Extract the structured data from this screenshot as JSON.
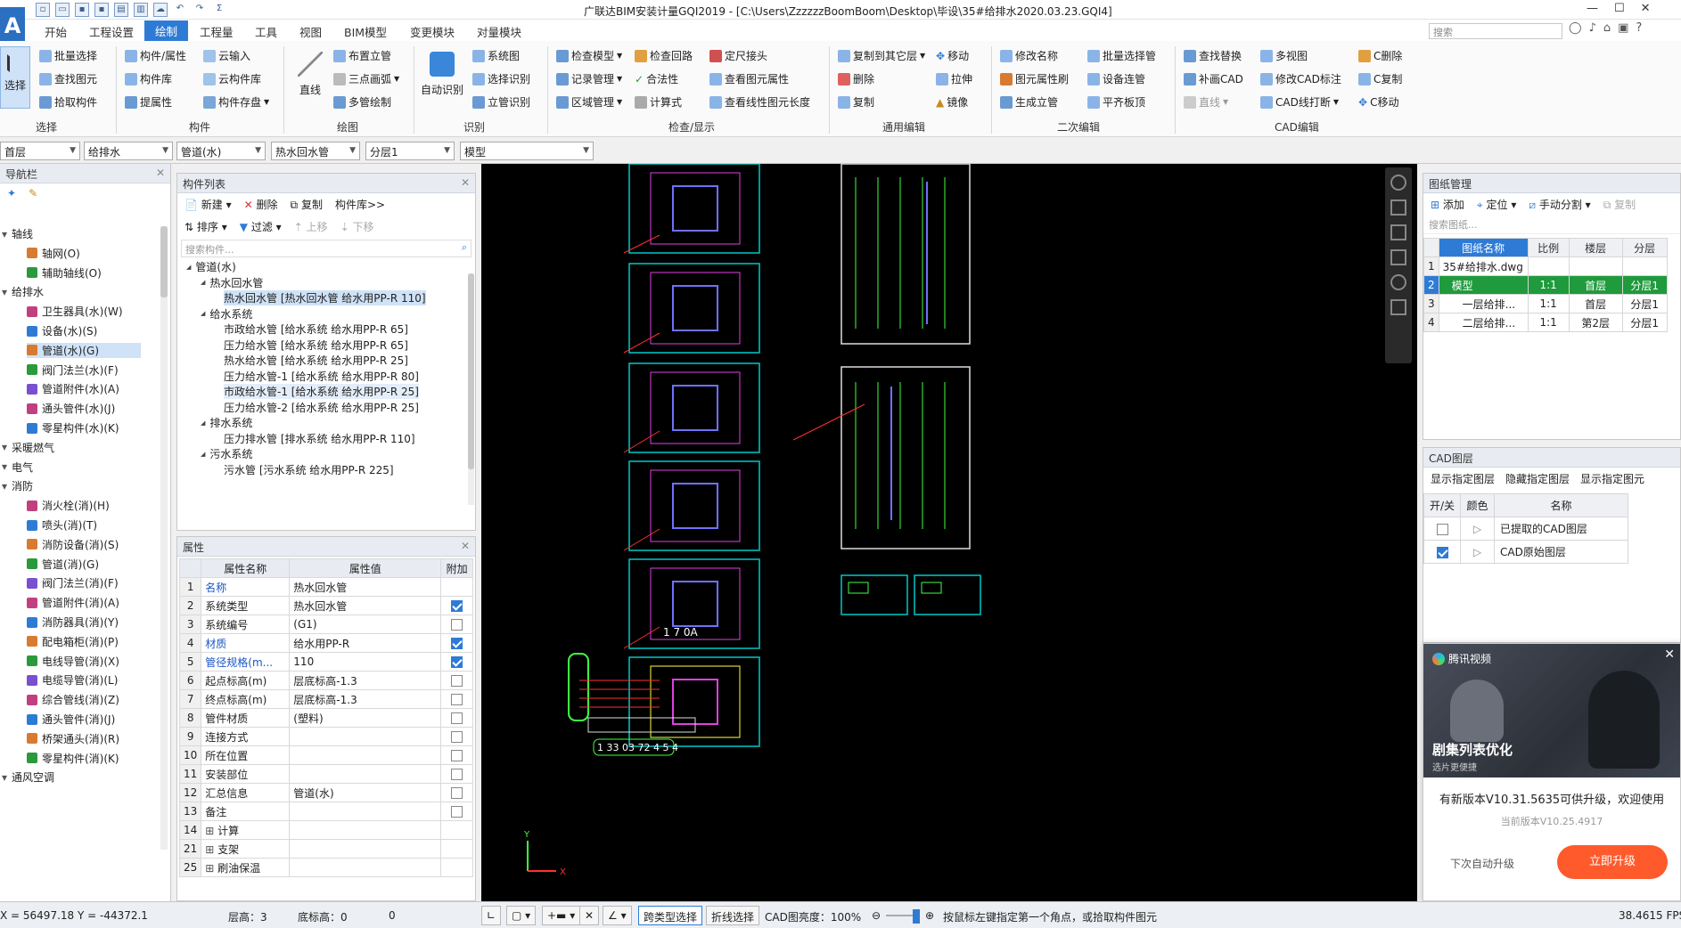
{
  "window": {
    "title": "广联达BIM安装计量GQI2019 - [C:\\Users\\ZzzzzzBoomBoom\\Desktop\\毕设\\35#给排水2020.03.23.GQI4]",
    "search_placeholder": "搜索",
    "logo": "A"
  },
  "tabs": [
    "开始",
    "工程设置",
    "绘制",
    "工程量",
    "工具",
    "视图",
    "BIM模型",
    "变更模块",
    "对量模块"
  ],
  "active_tab": "绘制",
  "ribbon": {
    "select": {
      "big": "选择",
      "items": [
        "批量选择",
        "查找图元",
        "拾取构件"
      ],
      "group": "选择"
    },
    "component": {
      "items": [
        "构件/属性",
        "构件库",
        "提属性",
        "云输入",
        "云构件库",
        "构件存盘"
      ],
      "group": "构件"
    },
    "draw": {
      "big": "直线",
      "items": [
        "布置立管",
        "三点画弧",
        "多管绘制"
      ],
      "group": "绘图"
    },
    "identify": {
      "big": "自动识别",
      "items": [
        "系统图",
        "选择识别",
        "立管识别"
      ],
      "group": "识别"
    },
    "check": {
      "items": [
        "检查模型",
        "记录管理",
        "区域管理",
        "检查回路",
        "合法性",
        "计算式",
        "定尺接头",
        "查看图元属性",
        "查看线性图元长度"
      ],
      "group": "检查/显示"
    },
    "general_edit": {
      "items": [
        "复制到其它层",
        "删除",
        "复制",
        "移动",
        "拉伸",
        "镜像"
      ],
      "group": "通用编辑"
    },
    "secondary_edit": {
      "items": [
        "修改名称",
        "图元属性刷",
        "生成立管",
        "批量选择管",
        "设备连管",
        "平齐板顶"
      ],
      "group": "二次编辑"
    },
    "cad_edit": {
      "items": [
        "查找替换",
        "补画CAD",
        "直线",
        "多视图",
        "修改CAD标注",
        "CAD线打断",
        "C删除",
        "C复制",
        "C移动"
      ],
      "group": "CAD编辑"
    }
  },
  "selectors": [
    "首层",
    "给排水",
    "管道(水)",
    "热水回水管",
    "分层1",
    "模型"
  ],
  "nav": {
    "title": "导航栏",
    "items": [
      {
        "label": "轴线",
        "level": 0
      },
      {
        "label": "轴网(O)",
        "level": 1
      },
      {
        "label": "辅助轴线(O)",
        "level": 1
      },
      {
        "label": "给排水",
        "level": 0
      },
      {
        "label": "卫生器具(水)(W)",
        "level": 1
      },
      {
        "label": "设备(水)(S)",
        "level": 1
      },
      {
        "label": "管道(水)(G)",
        "level": 1,
        "selected": true
      },
      {
        "label": "阀门法兰(水)(F)",
        "level": 1
      },
      {
        "label": "管道附件(水)(A)",
        "level": 1
      },
      {
        "label": "通头管件(水)(J)",
        "level": 1
      },
      {
        "label": "零星构件(水)(K)",
        "level": 1
      },
      {
        "label": "采暖燃气",
        "level": 0
      },
      {
        "label": "电气",
        "level": 0
      },
      {
        "label": "消防",
        "level": 0
      },
      {
        "label": "消火栓(消)(H)",
        "level": 1
      },
      {
        "label": "喷头(消)(T)",
        "level": 1
      },
      {
        "label": "消防设备(消)(S)",
        "level": 1
      },
      {
        "label": "管道(消)(G)",
        "level": 1
      },
      {
        "label": "阀门法兰(消)(F)",
        "level": 1
      },
      {
        "label": "管道附件(消)(A)",
        "level": 1
      },
      {
        "label": "消防器具(消)(Y)",
        "level": 1
      },
      {
        "label": "配电箱柜(消)(P)",
        "level": 1
      },
      {
        "label": "电线导管(消)(X)",
        "level": 1
      },
      {
        "label": "电缆导管(消)(L)",
        "level": 1
      },
      {
        "label": "综合管线(消)(Z)",
        "level": 1
      },
      {
        "label": "通头管件(消)(J)",
        "level": 1
      },
      {
        "label": "桥架通头(消)(R)",
        "level": 1
      },
      {
        "label": "零星构件(消)(K)",
        "level": 1
      },
      {
        "label": "通风空调",
        "level": 0
      }
    ]
  },
  "component_list": {
    "title": "构件列表",
    "toolbar": [
      "新建",
      "删除",
      "复制",
      "构件库>>"
    ],
    "toolbar2": [
      "排序",
      "过滤",
      "上移",
      "下移"
    ],
    "search_placeholder": "搜索构件...",
    "tree": [
      {
        "label": "管道(水)",
        "level": 0
      },
      {
        "label": "热水回水管",
        "level": 1
      },
      {
        "label": "热水回水管 [热水回水管 给水用PP-R 110]",
        "level": 2,
        "selected": true
      },
      {
        "label": "给水系统",
        "level": 1
      },
      {
        "label": "市政给水管 [给水系统 给水用PP-R 65]",
        "level": 2
      },
      {
        "label": "压力给水管 [给水系统 给水用PP-R 65]",
        "level": 2
      },
      {
        "label": "热水给水管 [给水系统 给水用PP-R 25]",
        "level": 2
      },
      {
        "label": "压力给水管-1 [给水系统 给水用PP-R 80]",
        "level": 2
      },
      {
        "label": "市政给水管-1 [给水系统 给水用PP-R 25]",
        "level": 2,
        "hover": true
      },
      {
        "label": "压力给水管-2 [给水系统 给水用PP-R 25]",
        "level": 2
      },
      {
        "label": "排水系统",
        "level": 1
      },
      {
        "label": "压力排水管 [排水系统 给水用PP-R 110]",
        "level": 2
      },
      {
        "label": "污水系统",
        "level": 1
      },
      {
        "label": "污水管 [污水系统 给水用PP-R 225]",
        "level": 2
      }
    ]
  },
  "properties": {
    "title": "属性",
    "headers": [
      "属性名称",
      "属性值",
      "附加"
    ],
    "rows": [
      {
        "n": "1",
        "name": "名称",
        "value": "热水回水管",
        "blue": true,
        "check": null
      },
      {
        "n": "2",
        "name": "系统类型",
        "value": "热水回水管",
        "blue": false,
        "check": true
      },
      {
        "n": "3",
        "name": "系统编号",
        "value": "(G1)",
        "blue": false,
        "check": false
      },
      {
        "n": "4",
        "name": "材质",
        "value": "给水用PP-R",
        "blue": true,
        "check": true
      },
      {
        "n": "5",
        "name": "管径规格(m...",
        "value": "110",
        "blue": true,
        "check": true
      },
      {
        "n": "6",
        "name": "起点标高(m)",
        "value": "层底标高-1.3",
        "blue": false,
        "check": false
      },
      {
        "n": "7",
        "name": "终点标高(m)",
        "value": "层底标高-1.3",
        "blue": false,
        "check": false
      },
      {
        "n": "8",
        "name": "管件材质",
        "value": "(塑料)",
        "blue": false,
        "check": false
      },
      {
        "n": "9",
        "name": "连接方式",
        "value": "",
        "blue": false,
        "check": false
      },
      {
        "n": "10",
        "name": "所在位置",
        "value": "",
        "blue": false,
        "check": false
      },
      {
        "n": "11",
        "name": "安装部位",
        "value": "",
        "blue": false,
        "check": false
      },
      {
        "n": "12",
        "name": "汇总信息",
        "value": "管道(水)",
        "blue": false,
        "check": false
      },
      {
        "n": "13",
        "name": "备注",
        "value": "",
        "blue": false,
        "check": false
      },
      {
        "n": "14",
        "name": "计算",
        "value": "",
        "blue": false,
        "check": null,
        "expand": true
      },
      {
        "n": "21",
        "name": "支架",
        "value": "",
        "blue": false,
        "check": null,
        "expand": true
      },
      {
        "n": "25",
        "name": "刷油保温",
        "value": "",
        "blue": false,
        "check": null,
        "expand": true
      }
    ]
  },
  "canvas": {
    "labels": [
      "1 7 0A",
      "1 33 03 72 4 5 4"
    ]
  },
  "drawing_mgmt": {
    "title": "图纸管理",
    "toolbar": [
      "添加",
      "定位",
      "手动分割",
      "复制"
    ],
    "search_placeholder": "搜索图纸...",
    "headers": [
      "",
      "图纸名称",
      "比例",
      "楼层",
      "分层"
    ],
    "rows": [
      {
        "n": "1",
        "name": "35#给排水.dwg",
        "scale": "",
        "floor": "",
        "layer": ""
      },
      {
        "n": "2",
        "name": "模型",
        "scale": "1:1",
        "floor": "首层",
        "layer": "分层1"
      },
      {
        "n": "3",
        "name": "一层给排...",
        "scale": "1:1",
        "floor": "首层",
        "layer": "分层1"
      },
      {
        "n": "4",
        "name": "二层给排...",
        "scale": "1:1",
        "floor": "第2层",
        "layer": "分层1"
      }
    ]
  },
  "cad_layers": {
    "title": "CAD图层",
    "toolbar": [
      "显示指定图层",
      "隐藏指定图层",
      "显示指定图元"
    ],
    "headers": [
      "开/关",
      "颜色",
      "名称"
    ],
    "rows": [
      {
        "name": "已提取的CAD图层",
        "on": false
      },
      {
        "name": "CAD原始图层",
        "on": true
      }
    ]
  },
  "popup": {
    "brand": "腾讯视频",
    "banner_title": "剧集列表优化",
    "banner_sub": "选片更便捷",
    "message": "有新版本V10.31.5635可供升级，欢迎使用",
    "current": "当前版本V10.25.4917",
    "later": "下次自动升级",
    "upgrade": "立即升级",
    "accent": "#ff5a2c"
  },
  "status": {
    "coords": "X = 56497.18 Y = -44372.1",
    "floor_height": "层高：3",
    "base_height": "底标高：0",
    "zero": "0",
    "cross_select": "跨类型选择",
    "polyline_select": "折线选择",
    "cad_brightness": "CAD图亮度：100%",
    "hint": "按鼠标左键指定第一个角点，或拾取构件图元",
    "fps": "38.4615 FPS"
  }
}
